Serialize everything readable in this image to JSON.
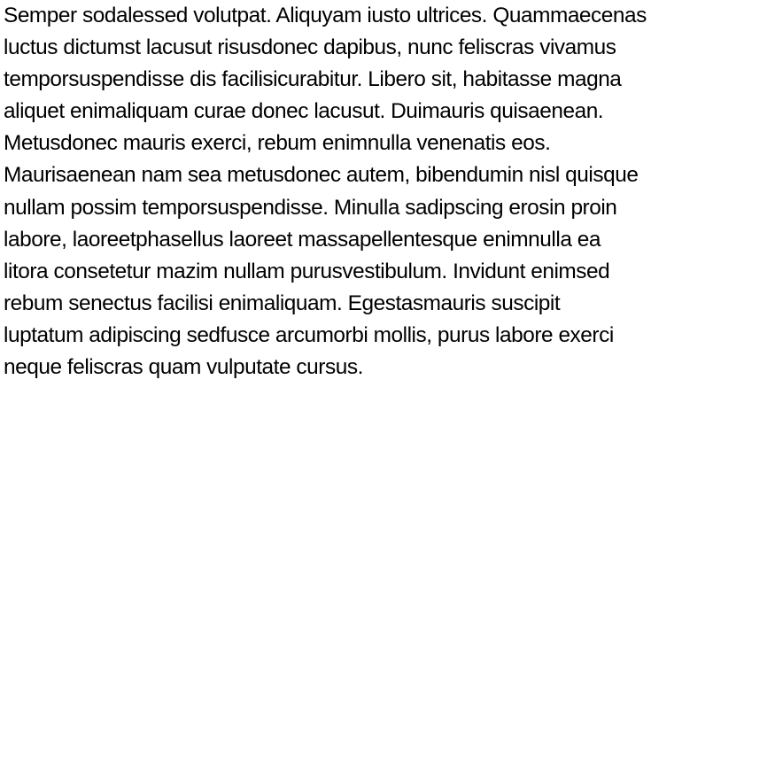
{
  "document": {
    "lines": [
      "Semper sodalessed volutpat. Aliquyam iusto ultrices. Quammaecenas",
      "luctus dictumst lacusut risusdonec dapibus, nunc feliscras vivamus",
      "temporsuspendisse dis facilisicurabitur. Libero sit, habitasse magna",
      "aliquet enimaliquam curae donec lacusut. Duimauris quisaenean.",
      "Metusdonec mauris exerci, rebum enimnulla venenatis eos.",
      "Maurisaenean nam sea metusdonec autem, bibendumin nisl quisque",
      "nullam possim temporsuspendisse. Minulla sadipscing erosin proin",
      "labore, laoreetphasellus laoreet massapellentesque enimnulla ea",
      "litora consetetur mazim nullam purusvestibulum. Invidunt enimsed",
      "rebum senectus facilisi enimaliquam. Egestasmauris suscipit",
      "luptatum adipiscing sedfusce arcumorbi mollis, purus labore exerci",
      "neque feliscras quam vulputate cursus."
    ]
  }
}
